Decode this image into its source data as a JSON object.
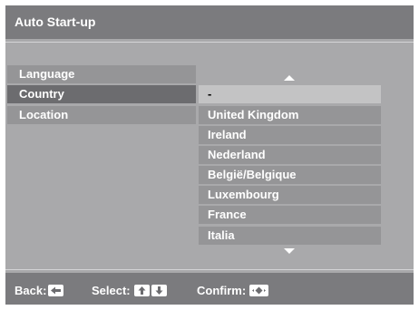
{
  "screen": {
    "title": "Auto Start-up"
  },
  "menu": {
    "items": [
      {
        "label": "Language",
        "selected": false
      },
      {
        "label": "Country",
        "selected": true
      },
      {
        "label": "Location",
        "selected": false
      }
    ]
  },
  "country_list": {
    "options": [
      {
        "label": "-",
        "selected": true
      },
      {
        "label": "United Kingdom",
        "selected": false
      },
      {
        "label": "Ireland",
        "selected": false
      },
      {
        "label": "Nederland",
        "selected": false
      },
      {
        "label": "België/Belgique",
        "selected": false
      },
      {
        "label": "Luxembourg",
        "selected": false
      },
      {
        "label": "France",
        "selected": false
      },
      {
        "label": "Italia",
        "selected": false
      }
    ],
    "scroll_up_icon": "triangle-up",
    "scroll_down_icon": "triangle-down"
  },
  "footer": {
    "back_label": "Back:",
    "select_label": "Select:",
    "confirm_label": "Confirm:",
    "back_key_icon": "left-arrow-key",
    "select_key_icons": [
      "up-arrow-key",
      "down-arrow-key"
    ],
    "confirm_key_icon": "center-key"
  },
  "colors": {
    "background": "#a9a9ab",
    "bar": "#7b7b7e",
    "item": "#959597",
    "item_selected": "#6c6c6f",
    "option_selected": "#c3c3c4"
  }
}
